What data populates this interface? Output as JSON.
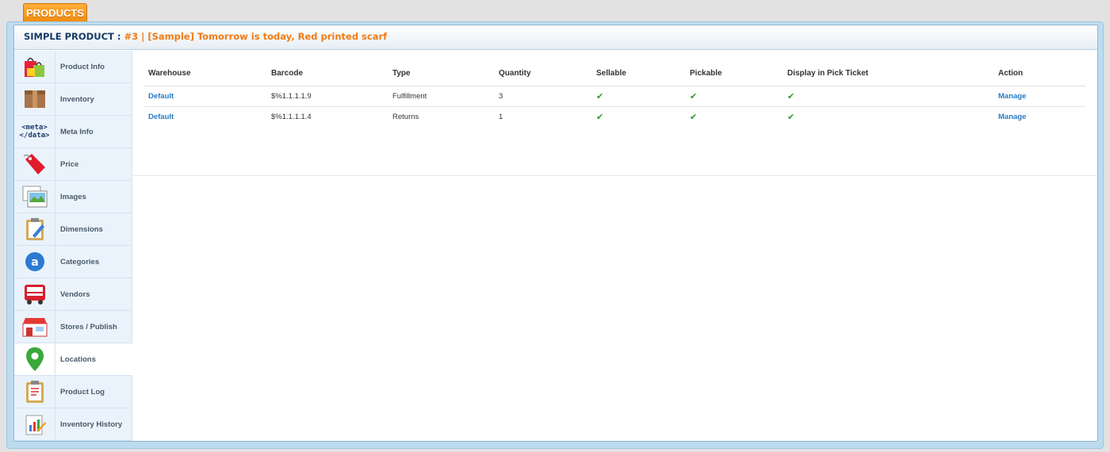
{
  "top_tab": {
    "label": "PRODUCTS"
  },
  "header": {
    "label": "SIMPLE PRODUCT :",
    "title": "#3 | [Sample] Tomorrow is today, Red printed scarf"
  },
  "sidebar": {
    "items": [
      {
        "label": "Product Info",
        "icon": "shopping-bags-icon"
      },
      {
        "label": "Inventory",
        "icon": "box-icon"
      },
      {
        "label": "Meta Info",
        "icon": "meta-data-icon",
        "icon_text": "<meta>\n</data>"
      },
      {
        "label": "Price",
        "icon": "price-tag-icon"
      },
      {
        "label": "Images",
        "icon": "images-icon"
      },
      {
        "label": "Dimensions",
        "icon": "clipboard-pencil-icon"
      },
      {
        "label": "Categories",
        "icon": "category-a-icon"
      },
      {
        "label": "Vendors",
        "icon": "truck-icon"
      },
      {
        "label": "Stores / Publish",
        "icon": "storefront-icon"
      },
      {
        "label": "Locations",
        "icon": "map-pin-icon",
        "active": true
      },
      {
        "label": "Product Log",
        "icon": "log-clipboard-icon"
      },
      {
        "label": "Inventory History",
        "icon": "history-chart-icon"
      }
    ]
  },
  "table": {
    "columns": [
      "Warehouse",
      "Barcode",
      "Type",
      "Quantity",
      "Sellable",
      "Pickable",
      "Display in Pick Ticket",
      "Action"
    ],
    "rows": [
      {
        "warehouse": "Default",
        "barcode": "$%1.1.1.1.9",
        "type": "Fulfillment",
        "quantity": "3",
        "sellable": "✔",
        "pickable": "✔",
        "display": "✔",
        "action": "Manage"
      },
      {
        "warehouse": "Default",
        "barcode": "$%1.1.1.1.4",
        "type": "Returns",
        "quantity": "1",
        "sellable": "✔",
        "pickable": "✔",
        "display": "✔",
        "action": "Manage"
      }
    ]
  },
  "colors": {
    "accent_orange": "#f28a0a",
    "header_title": "#f07b12",
    "link_blue": "#2a7cc4",
    "check_green": "#2c9a2c"
  }
}
